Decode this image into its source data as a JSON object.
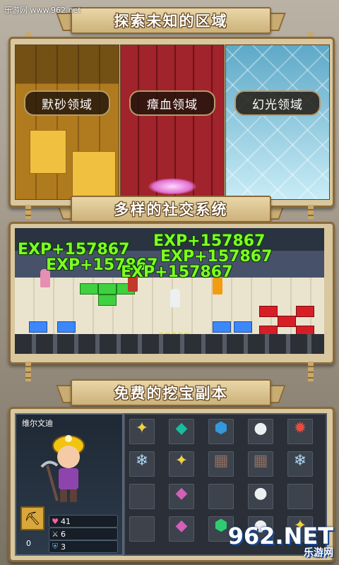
{
  "watermark": {
    "top_left": "乐游网 www.962.net",
    "logo_main": "962.NET",
    "logo_sub": "乐游网"
  },
  "sections": {
    "explore": {
      "title": "探索未知的区域",
      "zones": [
        "默砂领域",
        "瘴血领域",
        "幻光领域"
      ]
    },
    "social": {
      "title": "多样的社交系统",
      "exp_popup": "EXP+157867"
    },
    "treasure": {
      "title": "免费的挖宝副本",
      "hero_name": "维尔文迪",
      "stats": [
        {
          "icon": "heart-icon",
          "value": "41"
        },
        {
          "icon": "sword-icon",
          "value": "6"
        },
        {
          "icon": "shield-icon",
          "value": "3"
        }
      ],
      "pickaxe_count": "0"
    }
  },
  "colors": {
    "banner_fill": "#cdb27a",
    "frame_border": "#8a6a3a",
    "exp_green": "#7fff20"
  }
}
